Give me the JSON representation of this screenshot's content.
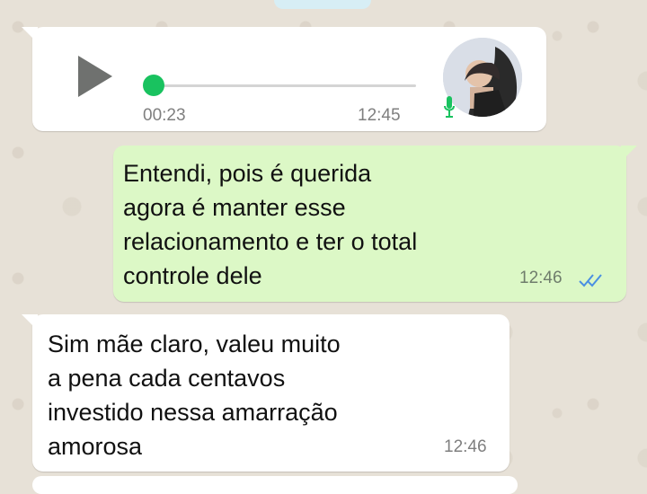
{
  "messages": {
    "audio": {
      "duration": "00:23",
      "time": "12:45"
    },
    "outgoing": {
      "text": "Entendi, pois é querida\nagora é manter esse\nrelacionamento e ter o total\ncontrole dele",
      "time": "12:46"
    },
    "incoming": {
      "text": "Sim mãe claro, valeu muito\na pena cada centavos\ninvestido nessa amarração\namorosa",
      "time": "12:46"
    }
  },
  "icons": {
    "play": "play-icon",
    "mic": "microphone-icon",
    "read_receipts": "double-check-icon"
  },
  "colors": {
    "background": "#e7e1d7",
    "incoming_bubble": "#ffffff",
    "outgoing_bubble": "#dcf8c6",
    "accent_green": "#19c25f",
    "read_blue": "#4a90e2"
  }
}
